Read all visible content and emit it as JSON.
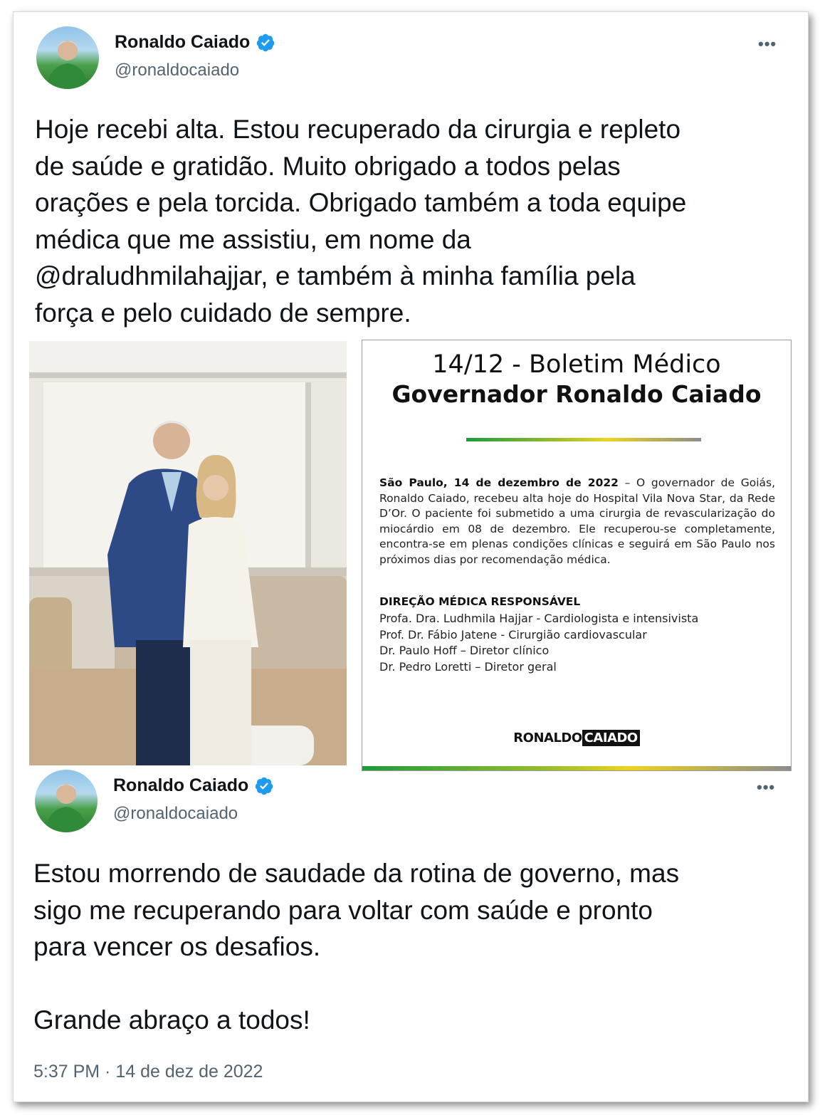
{
  "tweet1": {
    "name": "Ronaldo Caiado",
    "handle": "@ronaldocaiado",
    "more": "•••",
    "text": "Hoje recebi alta. Estou recuperado da cirurgia e repleto\nde saúde e gratidão. Muito obrigado a todos pelas\norações e pela torcida. Obrigado também a toda equipe\nmédica que me assistiu, em nome da\n@draludhmilahajjar, e também à minha família pela\nforça e pelo cuidado de sempre."
  },
  "bulletin": {
    "line1": "14/12 - Boletim Médico",
    "line2": "Governador Ronaldo Caiado",
    "intro_bold": "São Paulo, 14 de dezembro de 2022",
    "intro_rest": " – O governador de Goiás, Ronaldo Caiado, recebeu alta hoje do Hospital Vila Nova Star, da Rede D’Or. O paciente foi submetido a uma cirurgia de revascularização do miocárdio em 08 de dezembro. Ele recuperou-se completamente, encontra-se em plenas condições clínicas e seguirá em São Paulo nos próximos dias por recomendação médica.",
    "heading": "DIREÇÃO MÉDICA RESPONSÁVEL",
    "doctors": [
      "Profa. Dra. Ludhmila Hajjar - Cardiologista e intensivista",
      "Prof. Dr. Fábio Jatene - Cirurgião cardiovascular",
      "Dr. Paulo Hoff – Diretor clínico",
      "Dr. Pedro Loretti – Diretor geral"
    ],
    "logo_plain": "RONALDO",
    "logo_boxed": "CAIADO"
  },
  "tweet2": {
    "name": "Ronaldo Caiado",
    "handle": "@ronaldocaiado",
    "more": "•••",
    "text": "Estou morrendo de saudade da rotina de governo, mas\nsigo me recuperando para voltar com saúde e pronto\npara vencer os desafios.\n\nGrande abraço a todos!",
    "timestamp": "5:37 PM · 14 de dez de 2022"
  },
  "colors": {
    "verified": "#1d9bf0",
    "secondary_text": "#536471",
    "flag_green": "#1e9a3c",
    "flag_yellow": "#f0d21c"
  },
  "icons": [
    "verified-badge-icon",
    "more-options-icon"
  ]
}
